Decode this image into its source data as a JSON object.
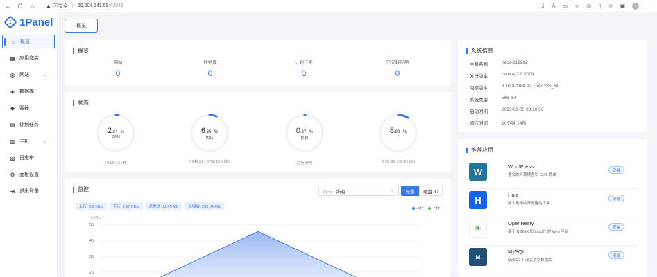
{
  "browser": {
    "back": "←",
    "reload": "C",
    "home": "⌂",
    "security_label": "不安全",
    "host": "60.204.141.59",
    "port": ":42043"
  },
  "sidebar": {
    "brand": "1Panel",
    "items": [
      {
        "label": "概览",
        "icon": "home-icon",
        "glyph": "⌂",
        "active": true
      },
      {
        "label": "应用商店",
        "icon": "grid-icon",
        "glyph": "▦"
      },
      {
        "label": "网站",
        "icon": "globe-icon",
        "glyph": "◍",
        "expand": true
      },
      {
        "label": "数据库",
        "icon": "database-icon",
        "glyph": "◈"
      },
      {
        "label": "容器",
        "icon": "docker-icon",
        "glyph": "◆"
      },
      {
        "label": "计划任务",
        "icon": "calendar-icon",
        "glyph": "▤"
      },
      {
        "label": "主机",
        "icon": "host-icon",
        "glyph": "▥",
        "expand": true
      },
      {
        "label": "日志审计",
        "icon": "log-icon",
        "glyph": "▧"
      },
      {
        "label": "面板设置",
        "icon": "settings-icon",
        "glyph": "⚙"
      },
      {
        "label": "退出登录",
        "icon": "logout-icon",
        "glyph": "⇥"
      }
    ]
  },
  "tab": {
    "label": "概览"
  },
  "overview": {
    "title": "概览",
    "items": [
      {
        "label": "网站",
        "value": "0"
      },
      {
        "label": "数据库",
        "value": "0"
      },
      {
        "label": "计划任务",
        "value": "0"
      },
      {
        "label": "已安装应用",
        "value": "0"
      }
    ]
  },
  "status": {
    "title": "状态",
    "gauges": [
      {
        "int": "2",
        "dec": ".34",
        "unit": "%",
        "label": "CPU",
        "sub": "( 0.05 / 2 ) 核",
        "percent": 2.34
      },
      {
        "int": "6",
        "dec": ".35",
        "unit": "%",
        "label": "内存",
        "sub": "( 240.59 / 3788.65 ) MB",
        "percent": 6.35
      },
      {
        "int": "0",
        "dec": ".67",
        "unit": "%",
        "label": "负载",
        "sub": "运行流畅",
        "percent": 0.67
      },
      {
        "int": "8",
        "dec": ".99",
        "unit": "%",
        "label": "/",
        "sub": "3.35 GB / 39.25 GB",
        "percent": 8.99
      }
    ]
  },
  "monitor": {
    "title": "监控",
    "nic_label": "网卡",
    "nic_value": "所有",
    "btn_network": "流量",
    "btn_io": "磁盘 IO",
    "tags": [
      "上行: 3.9 KB/s",
      "下行: 2.17 KB/s",
      "总发送: 11.45 MB",
      "总接收: 203.04 MB"
    ],
    "legend_up": "上行",
    "legend_down": "下行",
    "colors": {
      "up": "#3a78e6",
      "down": "#67c23a"
    }
  },
  "chart_data": {
    "type": "area",
    "ylabel": "( KB/s )",
    "yticks": [
      "50",
      "40",
      "30",
      "20"
    ],
    "ylim": [
      0,
      50
    ],
    "x": [
      0,
      1,
      2
    ],
    "series": [
      {
        "name": "上行",
        "values": [
          12,
          45.5,
          12
        ]
      }
    ]
  },
  "system": {
    "title": "系统信息",
    "rows": [
      {
        "key": "主机名称",
        "value": "hecs-219282"
      },
      {
        "key": "发行版本",
        "value": "centos-7.9.2009"
      },
      {
        "key": "内核版本",
        "value": "3.10.0-1160.92.1.el7.x86_64"
      },
      {
        "key": "系统类型",
        "value": "x86_64"
      },
      {
        "key": "启动时间",
        "value": "2023-08-05 08:10:50"
      },
      {
        "key": "运行时间",
        "value": "10分钟 14秒"
      }
    ]
  },
  "recommend": {
    "title": "推荐应用",
    "install_label": "安装",
    "apps": [
      {
        "name": "WordPress",
        "desc": "著名的开源博客和 CMS 系统",
        "logo": "W",
        "color": "#21759b"
      },
      {
        "name": "Halo",
        "desc": "强大易用的开源建站工具",
        "logo": "H",
        "color": "#1264e8"
      },
      {
        "name": "OpenResty",
        "desc": "基于 NGINX 和 LuaJIT 的 Web 平台",
        "logo": "❧",
        "color": "#ffffff"
      },
      {
        "name": "MySQL",
        "desc": "MySQL 开源关系型数据库",
        "logo": "M",
        "color": "#20507a"
      }
    ]
  }
}
